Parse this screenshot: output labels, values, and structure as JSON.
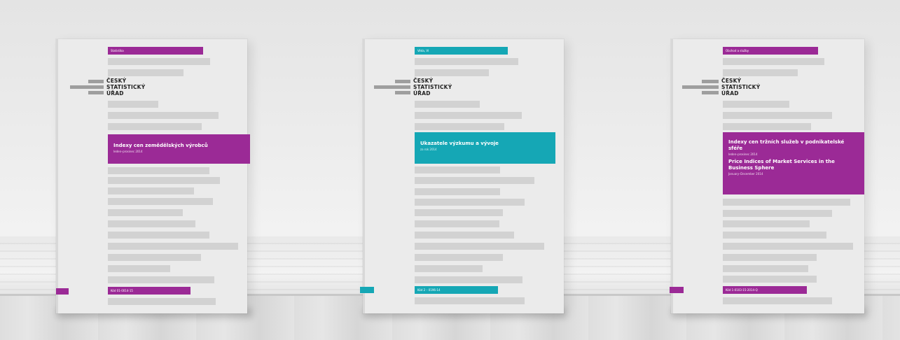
{
  "colors": {
    "accent_purple": "#9b2a96",
    "accent_teal": "#15a7b5",
    "placeholder_gray": "#d2d2d2"
  },
  "books": [
    {
      "top_tag": "Statistika",
      "logo": [
        "ČESKÝ",
        "STATISTICKÝ",
        "ÚŘAD"
      ],
      "title": "Indexy cen zemědělských výrobců",
      "subtitle": "leden–prosinec 2014",
      "bottom_tag": "Kód 01-0014-15"
    },
    {
      "top_tag": "Věda, VI",
      "logo": [
        "ČESKÝ",
        "STATISTICKÝ",
        "ÚŘAD"
      ],
      "title": "Ukazatele výzkumu a vývoje",
      "subtitle": "za rok 2014",
      "bottom_tag": "Kód 2 – 0196-14"
    },
    {
      "top_tag": "Obchod a služby",
      "logo": [
        "ČESKÝ",
        "STATISTICKÝ",
        "ÚŘAD"
      ],
      "title": "Indexy cen tržních služeb v podnikatelské sféře",
      "subtitle": "leden–prosinec 2014",
      "title2": "Price Indices of Market Services in the Business Sphere",
      "subtitle2": "January–December 2014",
      "bottom_tag": "Kód 1-0103-15-2014-Q"
    }
  ]
}
